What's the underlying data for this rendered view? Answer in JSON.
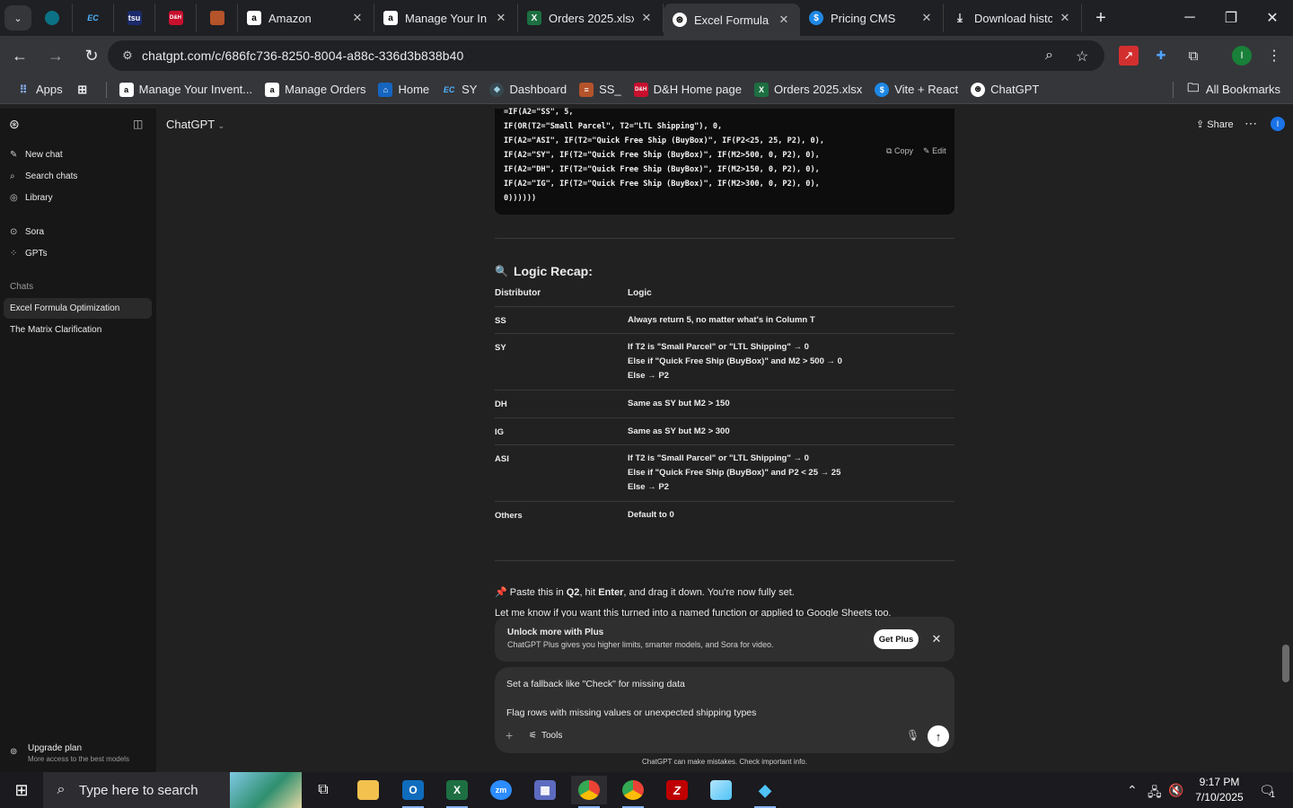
{
  "browser": {
    "tabs": [
      {
        "title": "Amazon",
        "icon": "amazon-icon",
        "active": false
      },
      {
        "title": "Manage Your In",
        "icon": "amazon-icon",
        "active": false
      },
      {
        "title": "Orders 2025.xlsx",
        "icon": "excel-icon",
        "active": false
      },
      {
        "title": "Excel Formula O",
        "icon": "chatgpt-icon",
        "active": true
      },
      {
        "title": "Pricing CMS",
        "icon": "dollar-icon",
        "active": false
      },
      {
        "title": "Download histo",
        "icon": "download-icon",
        "active": false
      }
    ],
    "pinned_tab_labels": [
      "",
      "EC",
      "tsu",
      "D&H",
      ""
    ],
    "url": "chatgpt.com/c/686fc736-8250-8004-a88c-336d3b838b40",
    "profile_initial": "I",
    "bookmarks": [
      {
        "label": "Apps"
      },
      {
        "label": ""
      },
      {
        "label": "Manage Your Invent..."
      },
      {
        "label": "Manage Orders"
      },
      {
        "label": "Home"
      },
      {
        "label": "SY"
      },
      {
        "label": "Dashboard"
      },
      {
        "label": "SS_"
      },
      {
        "label": "D&H Home page"
      },
      {
        "label": "Orders 2025.xlsx"
      },
      {
        "label": "Vite + React"
      },
      {
        "label": "ChatGPT"
      }
    ],
    "all_bookmarks": "All Bookmarks"
  },
  "sidebar": {
    "nav": [
      {
        "label": "New chat",
        "icon": "edit-icon"
      },
      {
        "label": "Search chats",
        "icon": "search-icon"
      },
      {
        "label": "Library",
        "icon": "library-icon"
      },
      {
        "label": "Sora",
        "icon": "sora-icon"
      },
      {
        "label": "GPTs",
        "icon": "grid-icon"
      }
    ],
    "chats_header": "Chats",
    "chats": [
      {
        "label": "Excel Formula Optimization",
        "active": true
      },
      {
        "label": "The Matrix Clarification",
        "active": false
      }
    ],
    "upgrade_title": "Upgrade plan",
    "upgrade_subtitle": "More access to the best models"
  },
  "header": {
    "model": "ChatGPT",
    "share": "Share",
    "avatar_initial": "I"
  },
  "code_block": {
    "lines": [
      "=IF(A2=\"SS\", 5,",
      "IF(OR(T2=\"Small Parcel\", T2=\"LTL Shipping\"), 0,",
      "IF(A2=\"ASI\", IF(T2=\"Quick Free Ship (BuyBox)\", IF(P2<25, 25, P2), 0),",
      "IF(A2=\"SY\", IF(T2=\"Quick Free Ship (BuyBox)\", IF(M2>500, 0, P2), 0),",
      "IF(A2=\"DH\", IF(T2=\"Quick Free Ship (BuyBox)\", IF(M2>150, 0, P2), 0),",
      "IF(A2=\"IG\", IF(T2=\"Quick Free Ship (BuyBox)\", IF(M2>300, 0, P2), 0),",
      "0))))))"
    ],
    "copy": "Copy",
    "edit": "Edit"
  },
  "recap": {
    "title": "Logic Recap:",
    "headers": [
      "Distributor",
      "Logic"
    ],
    "rows": [
      {
        "distributor": "SS",
        "logic": [
          "Always return 5, no matter what's in Column T"
        ]
      },
      {
        "distributor": "SY",
        "logic": [
          "If T2 is \"Small Parcel\" or \"LTL Shipping\" → 0",
          "Else if \"Quick Free Ship (BuyBox)\" and M2 > 500 → 0",
          "Else → P2"
        ]
      },
      {
        "distributor": "DH",
        "logic": [
          "Same as SY but M2 > 150"
        ]
      },
      {
        "distributor": "IG",
        "logic": [
          "Same as SY but M2 > 300"
        ]
      },
      {
        "distributor": "ASI",
        "logic": [
          "If T2 is \"Small Parcel\" or \"LTL Shipping\" → 0",
          "Else if \"Quick Free Ship (BuyBox)\" and P2 < 25 → 25",
          "Else → P2"
        ]
      },
      {
        "distributor": "Others",
        "logic": [
          "Default to 0"
        ]
      }
    ]
  },
  "message": {
    "paste_pre": "Paste this in ",
    "paste_q2": "Q2",
    "paste_mid": ", hit ",
    "paste_enter": "Enter",
    "paste_post": ", and drag it down. You're now fully set.",
    "followup": "Let me know if you want this turned into a named function or applied to Google Sheets too."
  },
  "upsell": {
    "title": "Unlock more with Plus",
    "subtitle": "ChatGPT Plus gives you higher limits, smarter models, and Sora for video.",
    "button": "Get Plus"
  },
  "composer": {
    "line1": "Set a fallback like \"Check\" for missing data",
    "line2": "Flag rows with missing values or unexpected shipping types",
    "tools": "Tools"
  },
  "disclaimer": "ChatGPT can make mistakes. Check important info.",
  "taskbar": {
    "search_placeholder": "Type here to search",
    "time": "9:17 PM",
    "date": "7/10/2025",
    "notifications": "1"
  },
  "colors": {
    "excel": "#1d6f42",
    "chrome_accent": "#8ab4f8",
    "user_blue": "#1a73e8"
  }
}
